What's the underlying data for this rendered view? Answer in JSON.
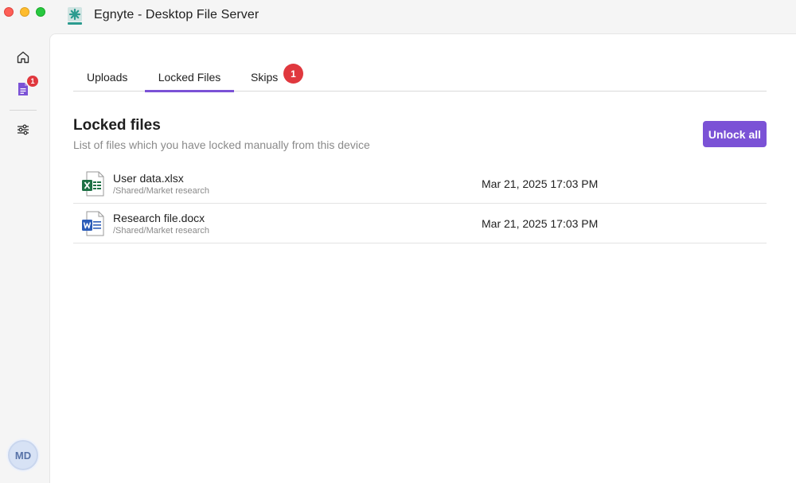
{
  "window": {
    "title": "Egnyte - Desktop File Server"
  },
  "sidebar": {
    "files_badge": "1",
    "avatar_initials": "MD"
  },
  "tabs": [
    {
      "label": "Uploads",
      "active": false
    },
    {
      "label": "Locked Files",
      "active": true
    },
    {
      "label": "Skips",
      "active": false,
      "badge": "1"
    }
  ],
  "section": {
    "title": "Locked files",
    "subtitle": "List of files which you have locked manually from this device",
    "unlock_all_label": "Unlock all"
  },
  "files": [
    {
      "name": "User data.xlsx",
      "path": "/Shared/Market research",
      "date": "Mar 21, 2025 17:03 PM",
      "icon": "excel-file-icon"
    },
    {
      "name": "Research file.docx",
      "path": "/Shared/Market research",
      "date": "Mar 21, 2025 17:03 PM",
      "icon": "word-file-icon"
    }
  ],
  "colors": {
    "accent": "#7b52d6",
    "badge": "#e0383e",
    "excel": "#1e7145",
    "word": "#2b5cb8"
  }
}
